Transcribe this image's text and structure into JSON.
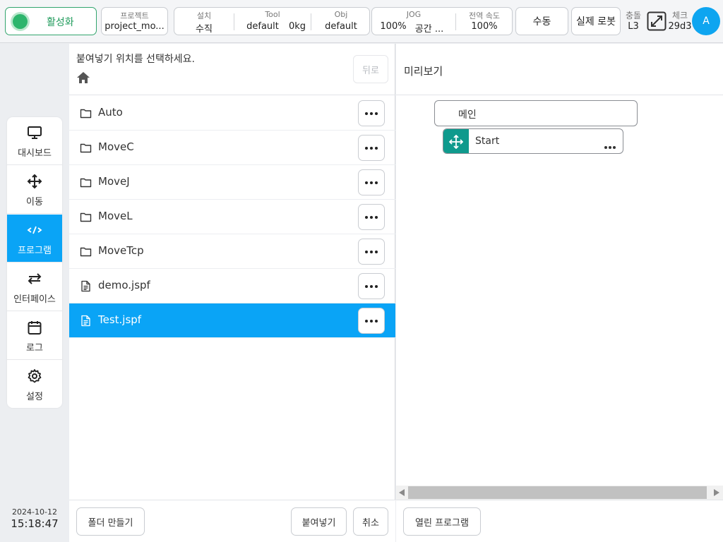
{
  "topbar": {
    "activate_label": "활성화",
    "project": {
      "label": "프로젝트",
      "value": "project_mo..."
    },
    "install": {
      "label": "설치",
      "value": "수직"
    },
    "tool": {
      "label": "Tool",
      "value": "default",
      "weight": "0kg"
    },
    "obj": {
      "label": "Obj",
      "value": "default"
    },
    "jog": {
      "label": "JOG",
      "speed": "100%",
      "space": "공간 ..."
    },
    "global_speed": {
      "label": "전역 속도",
      "value": "100%"
    },
    "mode_label": "수동",
    "robot_label": "실제 로봇",
    "collision": {
      "label": "충돌",
      "value": "L3"
    },
    "check": {
      "label": "체크",
      "value": "29d3"
    },
    "avatar": "A",
    "colors": {
      "accent": "#0aa4f6",
      "active_green": "#2db56c",
      "teal": "#0f9a8d"
    }
  },
  "sidebar": {
    "items": [
      {
        "label": "대시보드",
        "icon": "monitor-icon"
      },
      {
        "label": "이동",
        "icon": "move-icon"
      },
      {
        "label": "프로그램",
        "icon": "code-icon",
        "active": true
      },
      {
        "label": "인터페이스",
        "icon": "swap-icon"
      },
      {
        "label": "로그",
        "icon": "calendar-icon"
      },
      {
        "label": "설정",
        "icon": "gear-icon"
      }
    ],
    "date": "2024-10-12",
    "time": "15:18:47"
  },
  "left_panel": {
    "title": "붙여넣기 위치를 선택하세요.",
    "back_label": "뒤로",
    "files": [
      {
        "name": "Auto",
        "type": "folder"
      },
      {
        "name": "MoveC",
        "type": "folder"
      },
      {
        "name": "MoveJ",
        "type": "folder"
      },
      {
        "name": "MoveL",
        "type": "folder"
      },
      {
        "name": "MoveTcp",
        "type": "folder"
      },
      {
        "name": "demo.jspf",
        "type": "file"
      },
      {
        "name": "Test.jspf",
        "type": "file",
        "selected": true
      }
    ],
    "footer": {
      "new_folder": "폴더 만들기",
      "paste": "붙여넣기",
      "cancel": "취소"
    }
  },
  "right_panel": {
    "title": "미리보기",
    "tree": {
      "root": "메인",
      "child": "Start"
    },
    "footer": {
      "open_program": "열린 프로그램"
    }
  }
}
